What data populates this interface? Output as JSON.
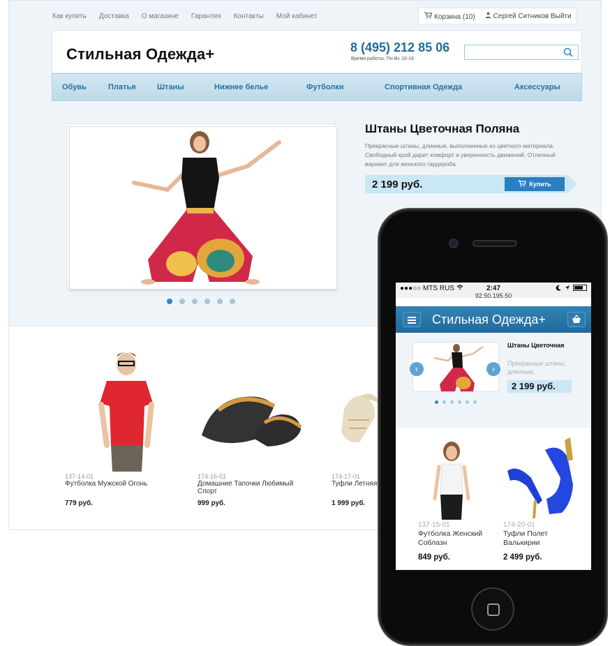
{
  "desktop": {
    "top_links": [
      "Как купить",
      "Доставка",
      "О магазине",
      "Гарантия",
      "Контакты",
      "Мой кабинет"
    ],
    "cart_label": "Корзина (10)",
    "user_label": "Сергей Ситников Выйти",
    "logo": "Стильная Одежда+",
    "phone": "8 (495) 212 85 06",
    "hours": "Время работы: Пн-Вс 10-19",
    "search_placeholder": "",
    "nav": [
      "Обувь",
      "Платья",
      "Штаны",
      "Нижнее белье",
      "Футболки",
      "Спортивная Одежда",
      "Аксессуары"
    ],
    "featured": {
      "title": "Штаны Цветочная Поляна",
      "description": "Прекрасные штаны, длинные, выполненные из цветного материала. Свободный крой дарит комфорт и уверенность движений. Отличный вариант для женского гардероба.",
      "price": "2 199 руб.",
      "buy_label": "Купить"
    },
    "slider_dots": 6,
    "slider_active": 0,
    "products": [
      {
        "sku": "137-14-01",
        "name": "Футболка Мужской Огонь",
        "price": "779 руб."
      },
      {
        "sku": "174-16-01",
        "name": "Домашние Тапочки Любимый Спорт",
        "price": "999 руб."
      },
      {
        "sku": "174-17-01",
        "name": "Туфли Летняя",
        "price": "1 999 руб."
      }
    ]
  },
  "mobile": {
    "carrier": "●●●○○ MTS RUS",
    "time": "2:47",
    "url": "92.50.195.50",
    "title": "Стильная Одежда+",
    "featured": {
      "title": "Штаны Цветочная",
      "description": "Прекрасные штаны, длинные,",
      "price": "2 199 руб."
    },
    "slider_dots": 6,
    "slider_active": 0,
    "products": [
      {
        "sku": "137-15-01",
        "name": "Футболка Женский Соблазн",
        "price": "849 руб."
      },
      {
        "sku": "174-20-01",
        "name": "Туфли Полет Валькирии",
        "price": "2 499 руб."
      }
    ]
  },
  "colors": {
    "accent": "#2673a1",
    "brand_blue": "#1f6a9b",
    "price_bg": "#c9e7f5",
    "buy_button": "#2b7fc0"
  },
  "icons": [
    "cart-icon",
    "user-icon",
    "search-icon",
    "menu-icon",
    "basket-icon",
    "wifi-icon",
    "battery-icon",
    "chevron-left-icon",
    "chevron-right-icon"
  ]
}
